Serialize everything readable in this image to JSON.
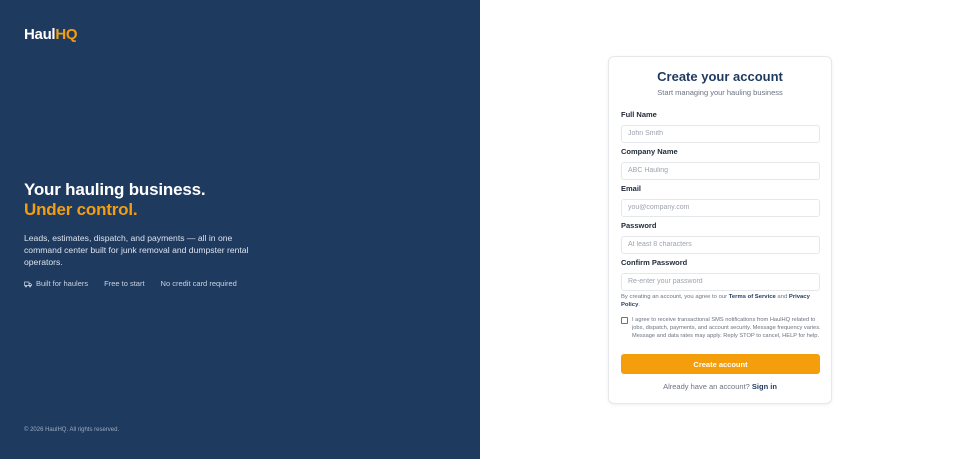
{
  "brand": {
    "name_part1": "Haul",
    "name_part2": "HQ",
    "accent_color": "#f59e0b",
    "primary_color": "#1f3a5f"
  },
  "hero": {
    "headline_line1": "Your hauling business.",
    "headline_line2": "Under control.",
    "description": "Leads, estimates, dispatch, and payments — all in one command center built for junk removal and dumpster rental operators.",
    "features": [
      {
        "icon": "truck-icon",
        "label": "Built for haulers"
      },
      {
        "icon": "",
        "label": "Free to start"
      },
      {
        "icon": "",
        "label": "No credit card required"
      }
    ]
  },
  "footer": {
    "copyright": "© 2026 HaulHQ. All rights reserved."
  },
  "form": {
    "title": "Create your account",
    "subtitle": "Start managing your hauling business",
    "fields": [
      {
        "label": "Full Name",
        "placeholder": "John Smith",
        "value": ""
      },
      {
        "label": "Company Name",
        "placeholder": "ABC Hauling",
        "value": ""
      },
      {
        "label": "Email",
        "placeholder": "you@company.com",
        "value": ""
      },
      {
        "label": "Password",
        "placeholder": "At least 8 characters",
        "value": ""
      },
      {
        "label": "Confirm Password",
        "placeholder": "Re-enter your password",
        "value": ""
      }
    ],
    "terms_prefix": "By creating an account, you agree to our ",
    "terms_link": "Terms of Service",
    "terms_and": " and ",
    "privacy_link": "Privacy Policy",
    "terms_suffix": ".",
    "sms_consent": "I agree to receive transactional SMS notifications from HaulHQ related to jobs, dispatch, payments, and account security. Message frequency varies. Message and data rates may apply. Reply STOP to cancel, HELP for help.",
    "sms_checked": false,
    "submit_label": "Create account",
    "signin_prompt": "Already have an account? ",
    "signin_link": "Sign in"
  }
}
